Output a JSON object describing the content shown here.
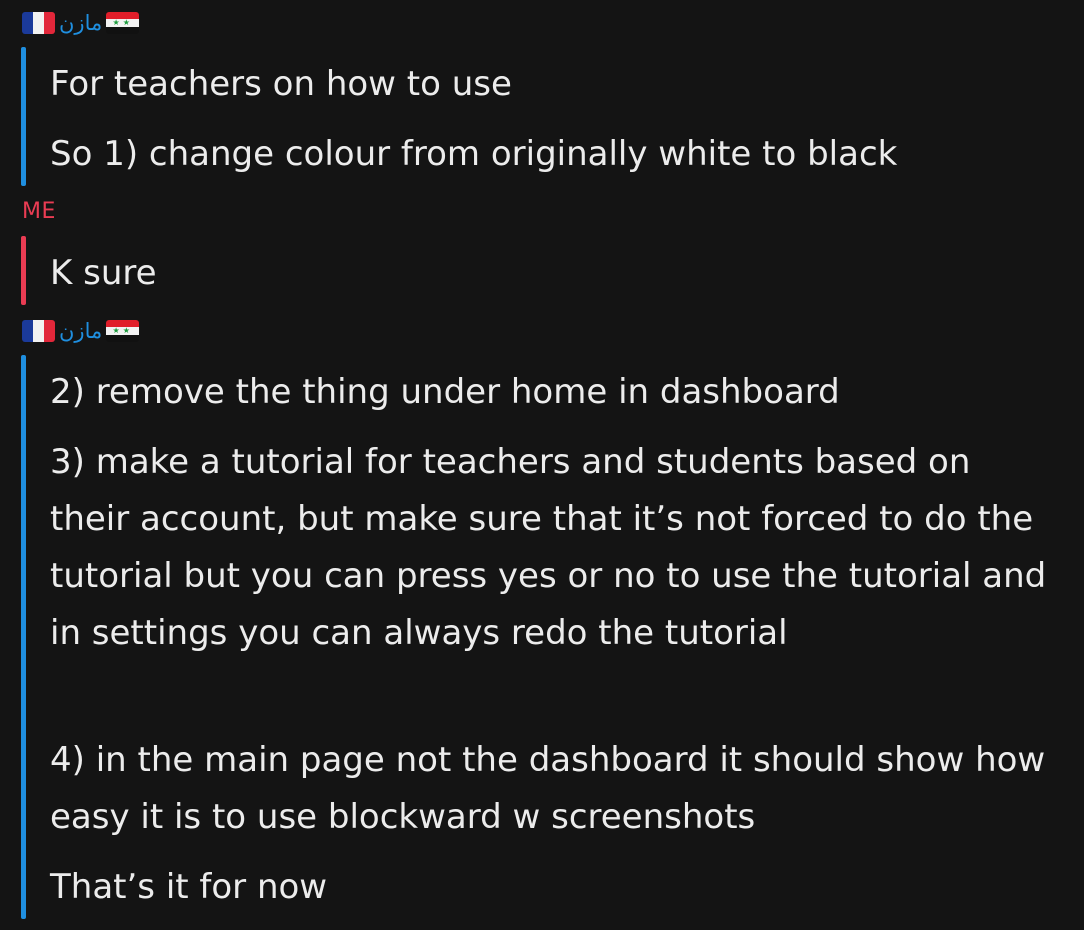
{
  "groups": [
    {
      "sender": "مازن",
      "flags": [
        "france-flag-icon",
        "syria-flag-icon"
      ],
      "messages": [
        "For teachers on how to use",
        "So 1) change colour from originally white to black"
      ]
    },
    {
      "sender": "ME",
      "messages": [
        "K sure"
      ]
    },
    {
      "sender": "مازن",
      "flags": [
        "france-flag-icon",
        "syria-flag-icon"
      ],
      "messages": [
        "2) remove the thing under home in dashboard",
        "3) make a tutorial for teachers and students based on their account, but make sure that it’s not forced to do the tutorial but you can press yes or no to use the tutorial and in settings you can always redo the tutorial",
        "4) in the main page not the dashboard it should show how easy it is to use blockward w screenshots",
        "That’s it for now"
      ]
    }
  ],
  "colors": {
    "background": "#141414",
    "them_accent": "#1f8fe0",
    "me_accent": "#ea3c53",
    "text": "#ececec"
  }
}
